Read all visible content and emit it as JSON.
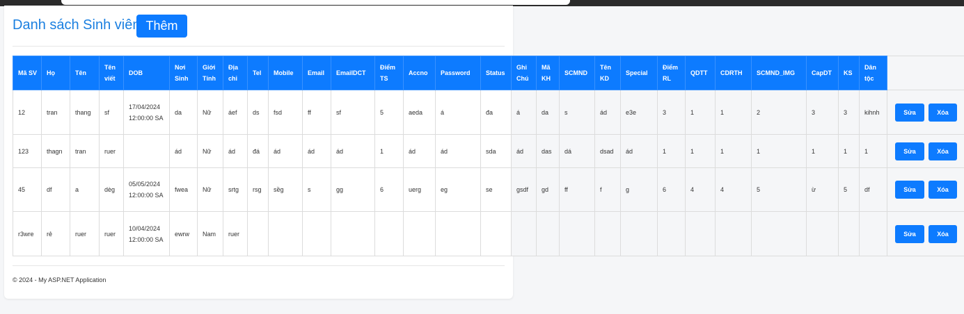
{
  "page": {
    "title": "Danh sách Sinh viên",
    "add_label": "Thêm",
    "footer": "© 2024 - My ASP.NET Application"
  },
  "table": {
    "headers": [
      "Mã SV",
      "Họ",
      "Tên",
      "Tên viết",
      "DOB",
      "Nơi Sinh",
      "Giới Tính",
      "Địa chỉ",
      "Tel",
      "Mobile",
      "Email",
      "EmailDCT",
      "Điểm TS",
      "Accno",
      "Password",
      "Status",
      "Ghi Chú",
      "Mã KH",
      "SCMND",
      "Tên KD",
      "Special",
      "Điểm RL",
      "QDTT",
      "CDRTH",
      "SCMND_IMG",
      "CapDT",
      "KS",
      "Dân tộc",
      ""
    ],
    "rows": [
      [
        "12",
        "tran",
        "thang",
        "sf",
        "17/04/2024 12:00:00 SA",
        "da",
        "Nữ",
        "áef",
        "ds",
        "fsd",
        "ff",
        "sf",
        "5",
        "aeda",
        "á",
        "đa",
        "á",
        "da",
        "s",
        "ád",
        "e3e",
        "3",
        "1",
        "1",
        "2",
        "3",
        "3",
        "kihnh"
      ],
      [
        "123",
        "thagn",
        "tran",
        "ruer",
        "",
        "ád",
        "Nữ",
        "ád",
        "đá",
        "ád",
        "ád",
        "ád",
        "1",
        "ád",
        "ád",
        "sda",
        "ád",
        "das",
        "dá",
        "dsad",
        "ád",
        "1",
        "1",
        "1",
        "1",
        "1",
        "1",
        "1"
      ],
      [
        "45",
        "df",
        "a",
        "dèg",
        "05/05/2024 12:00:00 SA",
        "fwea",
        "Nữ",
        "srtg",
        "rsg",
        "sềg",
        "s",
        "gg",
        "6",
        "uerg",
        "eg",
        "se",
        "gsdf",
        "gd",
        "ff",
        "f",
        "g",
        "6",
        "4",
        "4",
        "5",
        "ừ",
        "5",
        "df"
      ],
      [
        "r3wre",
        "rẻ",
        "ruer",
        "ruer",
        "10/04/2024 12:00:00 SA",
        "ewrw",
        "Nam",
        "ruer",
        "",
        "",
        "",
        "",
        "",
        "",
        "",
        "",
        "",
        "",
        "",
        "",
        "",
        "",
        "",
        "",
        "",
        "",
        "",
        ""
      ]
    ],
    "edit_label": "Sửa",
    "delete_label": "Xóa"
  },
  "colors": {
    "accent": "#0d7bff",
    "title": "#1a7fe0",
    "page_bg": "#f5f6f8"
  }
}
